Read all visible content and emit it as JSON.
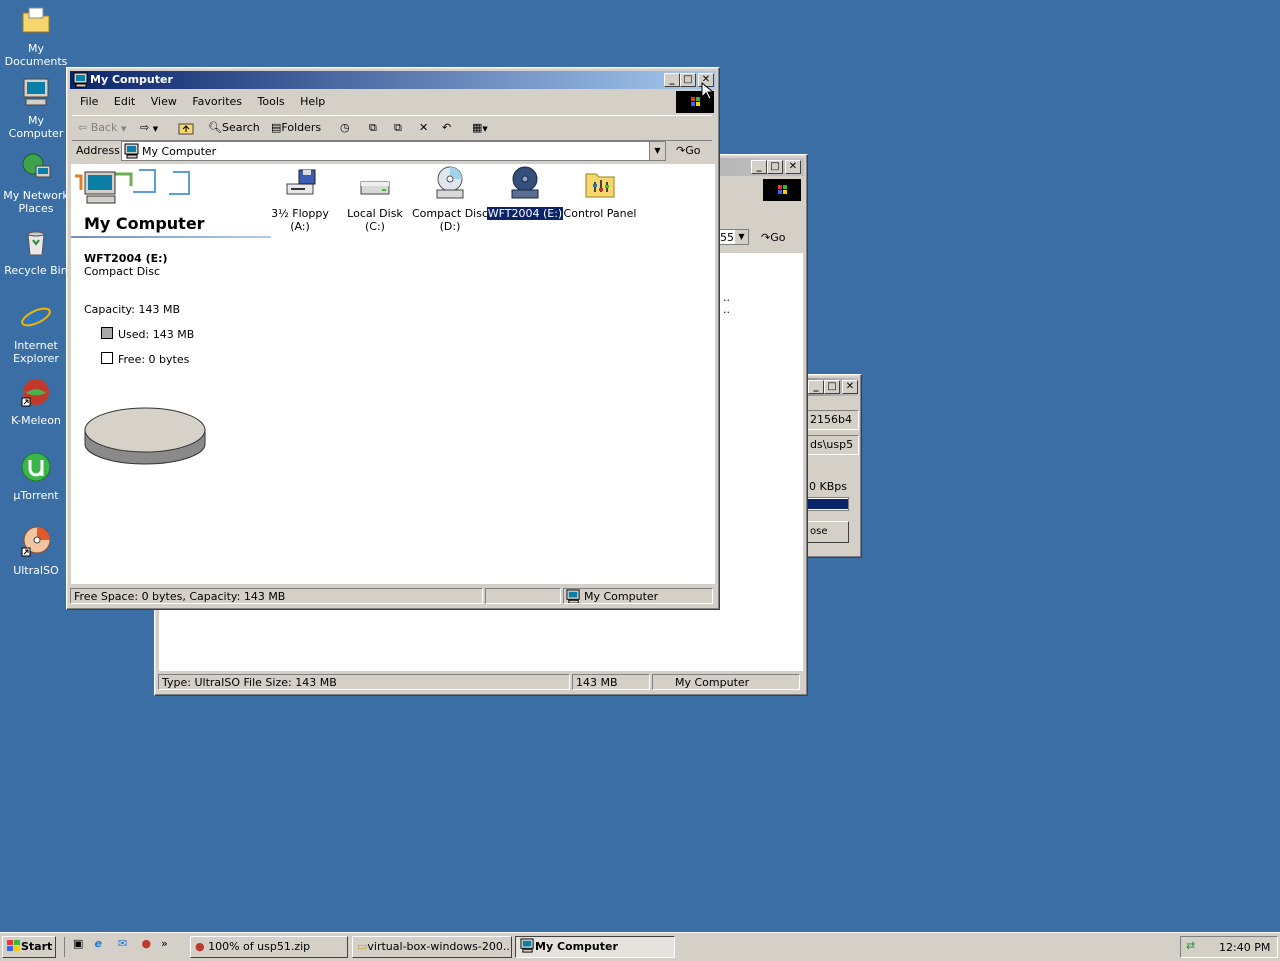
{
  "desktop": {
    "icons": [
      {
        "label": "My Documents",
        "icon": "my-documents-icon"
      },
      {
        "label": "My Computer",
        "icon": "my-computer-icon"
      },
      {
        "label_lines": [
          "My Network",
          "Places"
        ],
        "icon": "network-places-icon"
      },
      {
        "label": "Recycle Bin",
        "icon": "recycle-bin-icon"
      },
      {
        "label_lines": [
          "Internet",
          "Explorer"
        ],
        "icon": "internet-explorer-icon"
      },
      {
        "label": "K-Meleon",
        "icon": "k-meleon-icon"
      },
      {
        "label": "µTorrent",
        "icon": "utorrent-icon"
      },
      {
        "label": "UltraISO",
        "icon": "ultraiso-icon"
      }
    ]
  },
  "back_window": {
    "address_fragment": "55",
    "go_label": "Go",
    "list_fragments": [
      "..",
      ".."
    ],
    "status": {
      "type": "Type: UltraISO File Size: 143 MB",
      "size": "143 MB",
      "zone": "My Computer"
    }
  },
  "download_window": {
    "lines": [
      "2156b4",
      "ds\\usp5",
      "0 KBps"
    ],
    "button_fragment": "ose",
    "progress": 1.0
  },
  "main_window": {
    "title": "My Computer",
    "menu": [
      "File",
      "Edit",
      "View",
      "Favorites",
      "Tools",
      "Help"
    ],
    "toolbar": {
      "back": "Back",
      "search": "Search",
      "folders": "Folders"
    },
    "address": {
      "label": "Address",
      "value": "My Computer",
      "go": "Go"
    },
    "left_panel": {
      "heading": "My Computer",
      "drive_name": "WFT2004 (E:)",
      "drive_type": "Compact Disc",
      "capacity": "Capacity: 143 MB",
      "used": "Used: 143 MB",
      "free": "Free: 0 bytes"
    },
    "items": [
      {
        "label_lines": [
          "3½ Floppy",
          "(A:)"
        ],
        "icon": "floppy-drive-icon",
        "selected": false
      },
      {
        "label_lines": [
          "Local Disk (C:)"
        ],
        "icon": "hard-disk-icon",
        "selected": false
      },
      {
        "label_lines": [
          "Compact Disc",
          "(D:)"
        ],
        "icon": "cd-drive-icon",
        "selected": false
      },
      {
        "label_lines": [
          "WFT2004 (E:)"
        ],
        "icon": "cd-drive-disc-icon",
        "selected": true
      },
      {
        "label_lines": [
          "Control Panel"
        ],
        "icon": "control-panel-icon",
        "selected": false
      }
    ],
    "status": {
      "left": "Free Space: 0 bytes, Capacity: 143 MB",
      "zone": "My Computer"
    }
  },
  "taskbar": {
    "start": "Start",
    "quicklaunch_more": "»",
    "tasks": [
      {
        "label": "100% of usp51.zip",
        "icon": "k-meleon-icon",
        "active": false
      },
      {
        "label": "virtual-box-windows-200...",
        "icon": "folder-icon",
        "active": false
      },
      {
        "label": "My Computer",
        "icon": "my-computer-icon",
        "active": true
      }
    ],
    "clock": "12:40 PM"
  },
  "colors": {
    "desktop": "#3a6ea5",
    "title_active": "#0a246a",
    "selection": "#0a246a",
    "face": "#d4d0c8"
  }
}
